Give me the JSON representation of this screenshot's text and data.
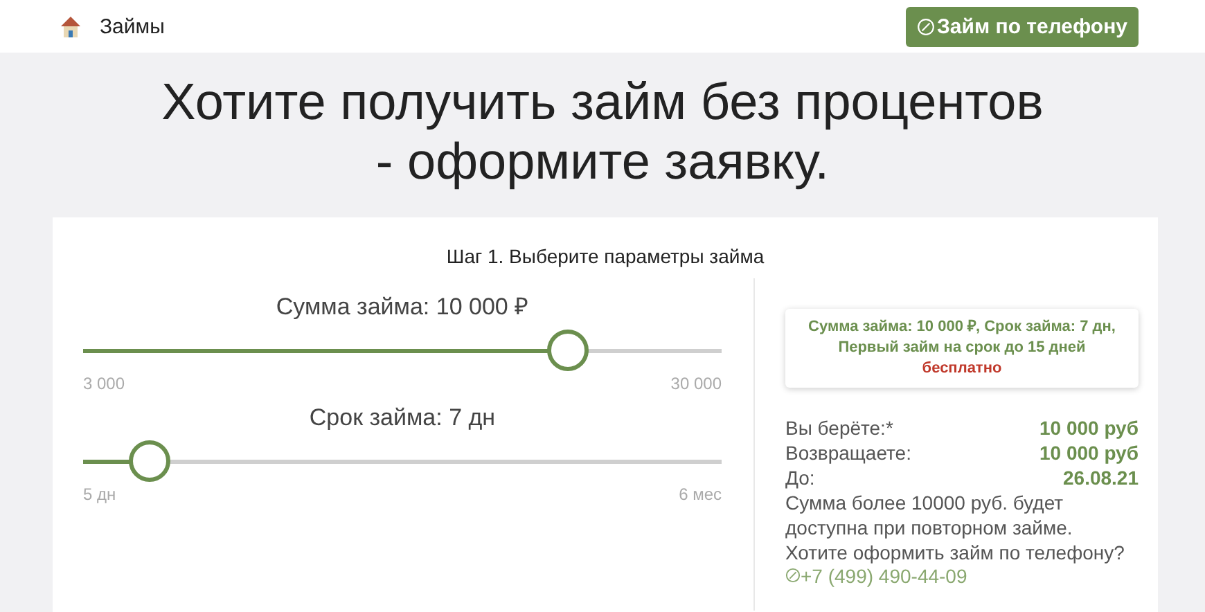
{
  "header": {
    "title": "Займы",
    "phone_button": "Займ по телефону"
  },
  "headline": "Хотите получить займ без процентов - оформите заявку.",
  "step_title": "Шаг 1. Выберите параметры займа",
  "sliders": [
    {
      "label": "Сумма займа: 10 000 ₽",
      "level": 0.76,
      "min": "3 000",
      "max": "30 000"
    },
    {
      "label": "Срок займа: 7 дн",
      "level": 0.104,
      "min": "5 дн",
      "max": "6 мес"
    }
  ],
  "summary": {
    "line": "Сумма займа: 10 000 ₽, Срок займа: 7 дн, Первый займ на срок до 15 дней",
    "highlight": "бесплатно"
  },
  "details": [
    {
      "label": "Вы берёте:*",
      "value": "10 000 руб"
    },
    {
      "label": "Возвращаете:",
      "value": "10 000 руб"
    },
    {
      "label": "До:",
      "value": "26.08.21"
    }
  ],
  "note": "Сумма более 10000 руб. будет доступна при повторном займе. Хотите оформить займ по телефону?",
  "phone": "+7 (499) 490-44-09"
}
